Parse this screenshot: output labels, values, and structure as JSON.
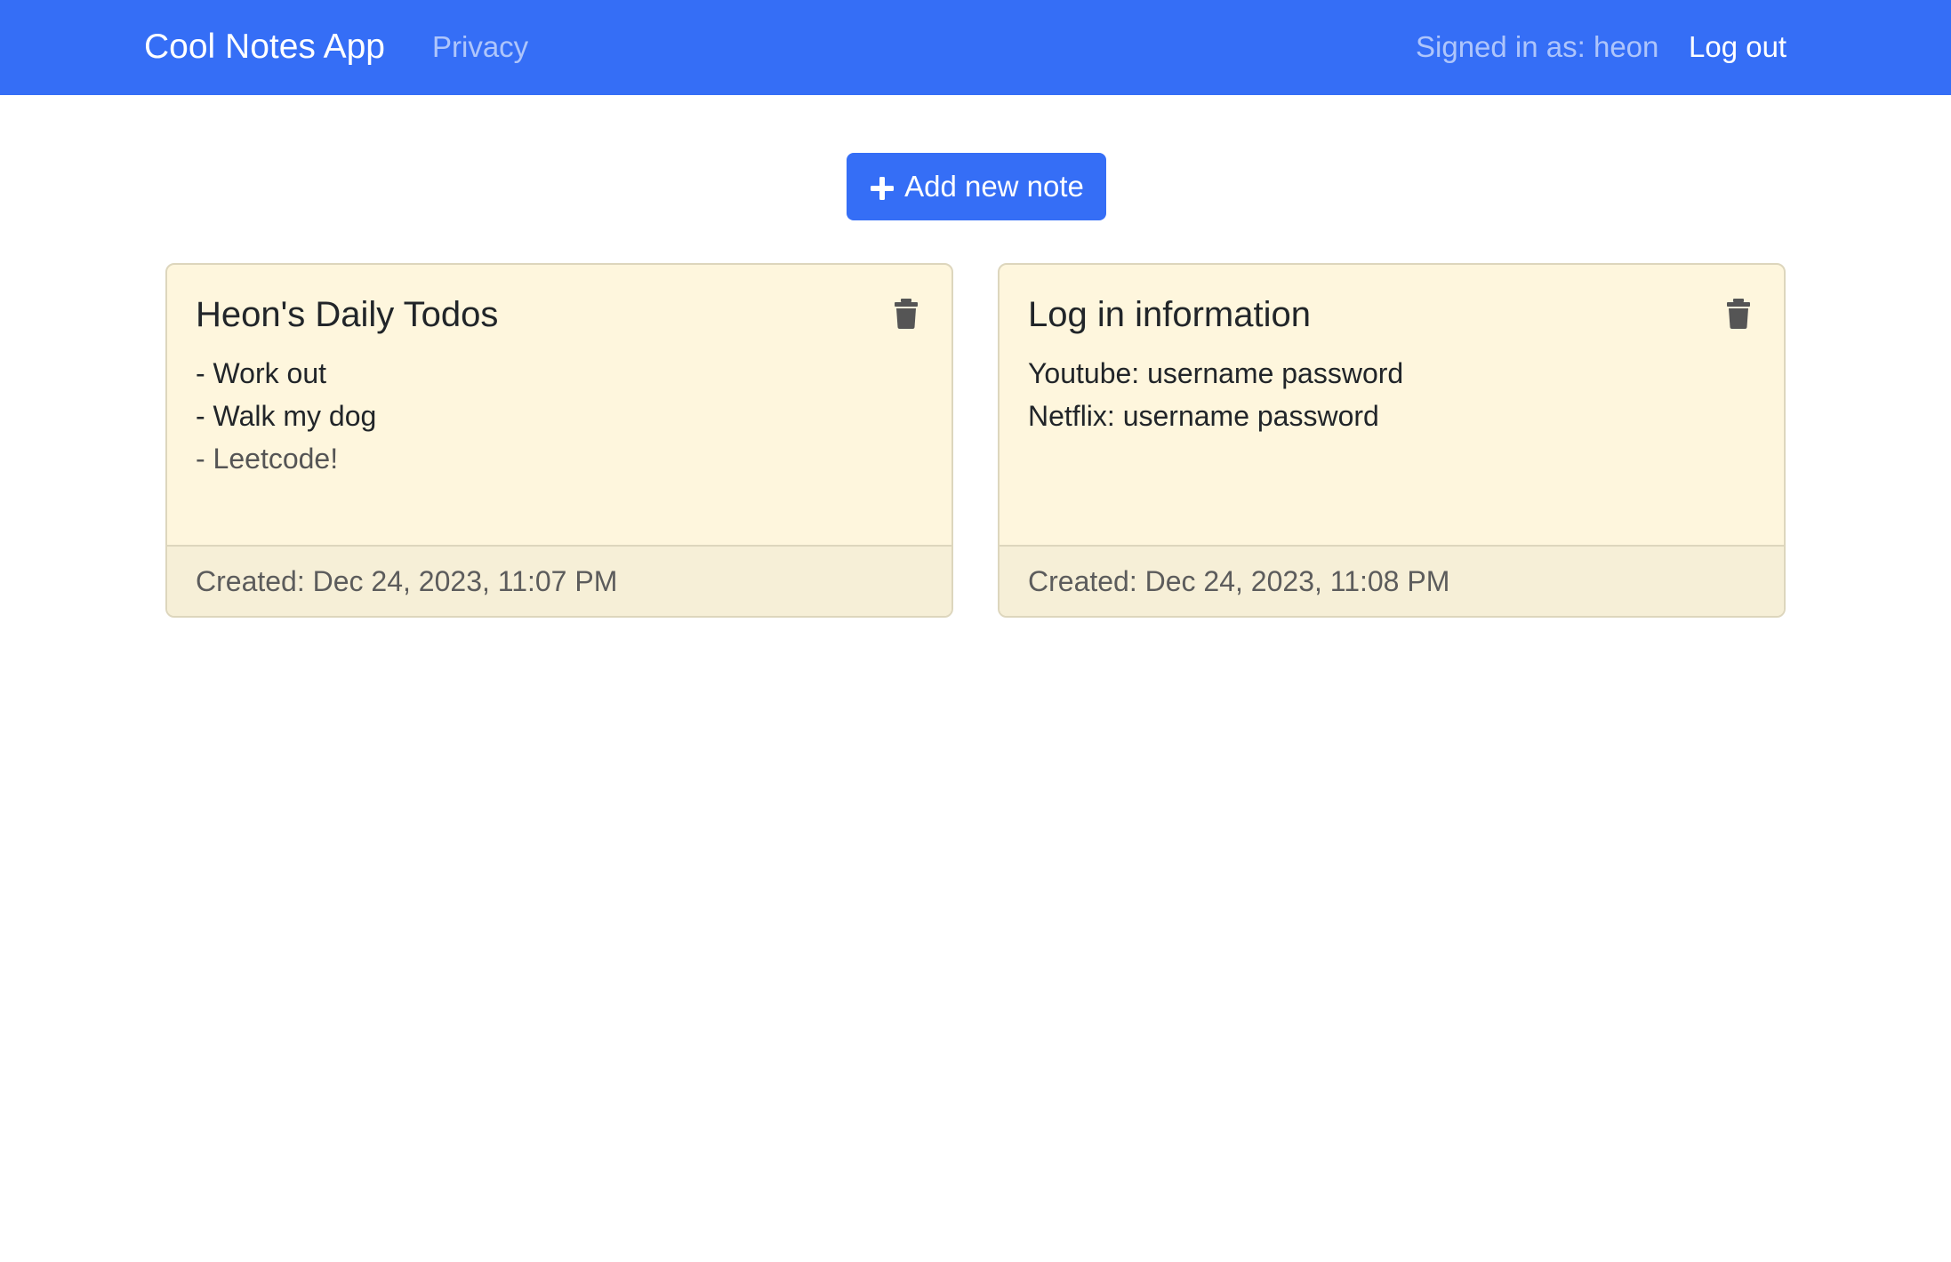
{
  "navbar": {
    "brand": "Cool Notes App",
    "privacy_link": "Privacy",
    "signed_in_text": "Signed in as: heon",
    "logout_link": "Log out",
    "color": "#356ef6"
  },
  "main": {
    "add_button": {
      "label": "Add new note",
      "icon": "plus-icon"
    },
    "notes": [
      {
        "title": "Heon's Daily Todos",
        "lines": [
          "- Work out",
          "- Walk my dog",
          "- Leetcode!"
        ],
        "created": "Created: Dec 24, 2023, 11:07 PM",
        "delete_icon": "trash-icon"
      },
      {
        "title": "Log in information",
        "lines": [
          "Youtube: username password",
          "Netflix: username password"
        ],
        "created": "Created: Dec 24, 2023, 11:08 PM",
        "delete_icon": "trash-icon"
      }
    ]
  },
  "colors": {
    "note_background": "#fef6dd",
    "note_footer": "#f6efd7",
    "note_border": "#ddd6bd"
  }
}
